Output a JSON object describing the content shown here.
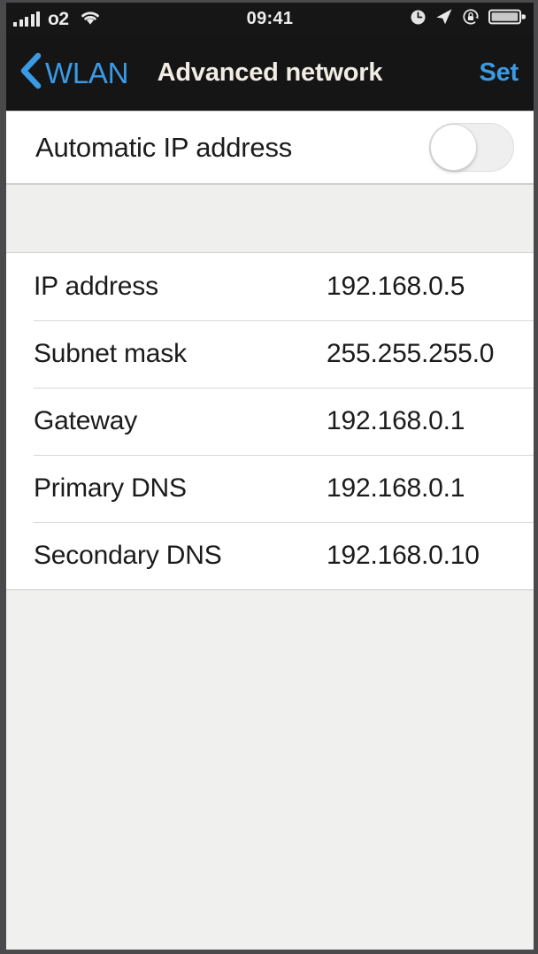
{
  "status_bar": {
    "signal_icon": "signal-bars-icon",
    "signal_bars_filled": 5,
    "carrier": "o2",
    "wifi_icon": "wifi-icon",
    "time": "09:41",
    "alarm_icon": "alarm-clock-icon",
    "location_icon": "location-arrow-icon",
    "rotation_lock_icon": "portrait-orientation-lock-icon",
    "battery_icon": "battery-icon",
    "battery_level_percent": 92,
    "background_color": "#161616",
    "text_color": "#e8e8e8"
  },
  "nav_bar": {
    "back_icon": "chevron-left-icon",
    "back_label": "WLAN",
    "title": "Advanced network",
    "action_label": "Set",
    "accent_color": "#3b9ae4",
    "title_color": "#f2ede4",
    "background_color": "#151515"
  },
  "toggle_section": {
    "label": "Automatic IP address",
    "toggle_name": "automatic-ip-address-toggle",
    "toggle_state": "off",
    "track_color": "#efefef",
    "knob_color": "#ffffff"
  },
  "settings_list": {
    "rows": [
      {
        "label": "IP address",
        "value": "192.168.0.5"
      },
      {
        "label": "Subnet mask",
        "value": "255.255.255.0"
      },
      {
        "label": "Gateway",
        "value": "192.168.0.1"
      },
      {
        "label": "Primary DNS",
        "value": "192.168.0.1"
      },
      {
        "label": "Secondary DNS",
        "value": "192.168.0.10"
      }
    ]
  },
  "colors": {
    "page_background": "#f0f0ee",
    "panel_background": "#ffffff",
    "separator": "#d8d8d8",
    "text_primary": "#1b1b1b",
    "frame": "#4a4a4d"
  }
}
